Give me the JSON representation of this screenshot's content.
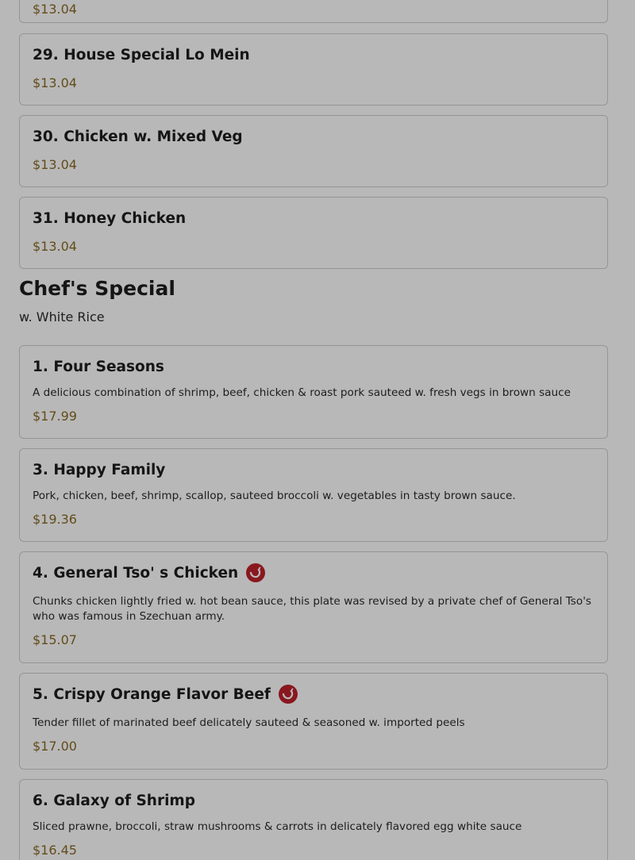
{
  "partial_item": {
    "price": "$13.04"
  },
  "noodle_items": [
    {
      "name": "29. House Special Lo Mein",
      "price": "$13.04"
    },
    {
      "name": "30. Chicken w. Mixed Veg",
      "price": "$13.04"
    },
    {
      "name": "31. Honey Chicken",
      "price": "$13.04"
    }
  ],
  "chefs_special": {
    "title": "Chef's Special",
    "subtitle": "w. White Rice",
    "items": [
      {
        "name": "1. Four Seasons",
        "description": "A delicious combination of shrimp, beef, chicken & roast pork sauteed w. fresh vegs in brown sauce",
        "price": "$17.99",
        "spicy": false
      },
      {
        "name": "3. Happy Family",
        "description": "Pork, chicken, beef, shrimp, scallop, sauteed broccoli w. vegetables in tasty brown sauce.",
        "price": "$19.36",
        "spicy": false
      },
      {
        "name": "4. General Tso' s Chicken",
        "description": "Chunks chicken lightly fried w. hot bean sauce, this plate was revised by a private chef of General Tso's who was famous in Szechuan army.",
        "price": "$15.07",
        "spicy": true
      },
      {
        "name": "5. Crispy Orange Flavor Beef",
        "description": "Tender fillet of marinated beef delicately sauteed & seasoned w. imported peels",
        "price": "$17.00",
        "spicy": true
      },
      {
        "name": "6. Galaxy of Shrimp",
        "description": "Sliced prawne, broccoli, straw mushrooms & carrots in delicately flavored egg white sauce",
        "price": "$16.45",
        "spicy": false
      }
    ]
  },
  "icons": {
    "spicy": "chili-pepper-icon"
  },
  "colors": {
    "price": "#8a6a26",
    "spicy_badge": "#c0212b",
    "overlay": "rgba(0,0,0,0.28)"
  }
}
